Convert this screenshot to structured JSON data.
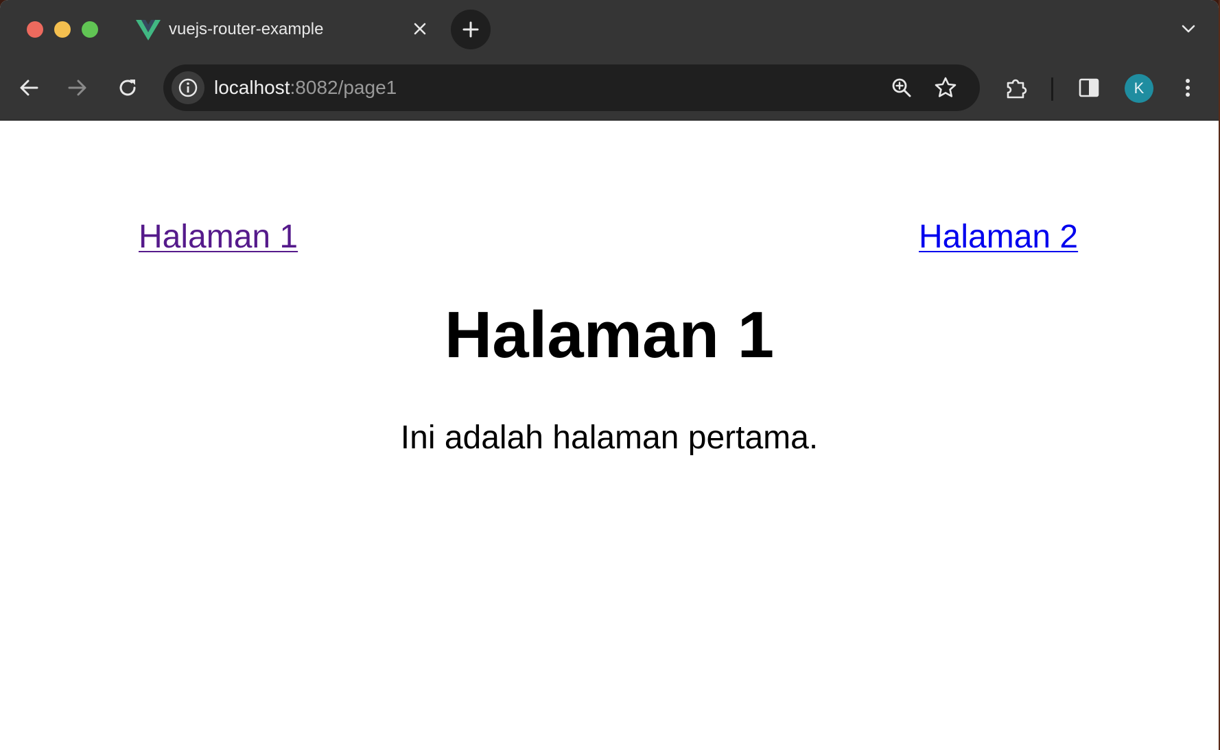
{
  "window_controls": {
    "close": "close",
    "minimize": "minimize",
    "zoom": "zoom"
  },
  "tab": {
    "title": "vuejs-router-example",
    "favicon": "vue-logo-icon"
  },
  "toolbar": {
    "url_host": "localhost",
    "url_rest": ":8082/page1",
    "profile_initial": "K"
  },
  "page": {
    "links": [
      {
        "label": "Halaman 1",
        "visited": true
      },
      {
        "label": "Halaman 2",
        "visited": false
      }
    ],
    "heading": "Halaman 1",
    "body_text": "Ini adalah halaman pertama."
  },
  "colors": {
    "chrome_bg": "#353535",
    "omnibox_bg": "#1f1f1f",
    "visited_link": "#551a8b",
    "link": "#0000ee",
    "vue_green": "#41b883",
    "vue_dark": "#35495e"
  }
}
